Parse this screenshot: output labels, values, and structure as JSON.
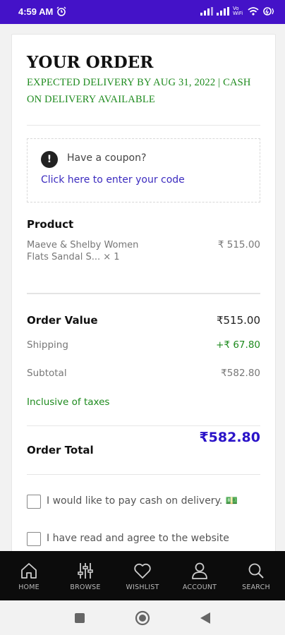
{
  "status_bar": {
    "time": "4:59 AM",
    "signal_text": "Vo WiFi",
    "icons": [
      "alarm-icon",
      "signal-icon",
      "wifi-icon",
      "battery-icon"
    ]
  },
  "order": {
    "title": "YOUR ORDER",
    "delivery_note": "EXPECTED DELIVERY BY AUG 31, 2022 | CASH ON DELIVERY AVAILABLE"
  },
  "coupon": {
    "prompt": "Have a coupon?",
    "link_text": "Click here to enter your code"
  },
  "product_section": {
    "header": "Product",
    "items": [
      {
        "name": "Maeve & Shelby Women Flats Sandal S...  × 1",
        "price": "₹ 515.00"
      }
    ]
  },
  "summary": {
    "order_value_label": "Order Value",
    "order_value": "₹515.00",
    "shipping_label": "Shipping",
    "shipping_value": "+₹ 67.80",
    "subtotal_label": "Subtotal",
    "subtotal_value": "₹582.80",
    "tax_note": "Inclusive of taxes",
    "total_label": "Order Total",
    "total_value": "₹582.80"
  },
  "options": {
    "cod_label": "I would like to pay cash on delivery. 💵",
    "terms_label": "I have read and agree to the website"
  },
  "bottom_nav": [
    {
      "label": "HOME",
      "icon": "home-icon"
    },
    {
      "label": "BROWSE",
      "icon": "sliders-icon"
    },
    {
      "label": "WISHLIST",
      "icon": "heart-icon"
    },
    {
      "label": "ACCOUNT",
      "icon": "user-icon"
    },
    {
      "label": "SEARCH",
      "icon": "search-icon"
    }
  ],
  "colors": {
    "status_bar": "#4412c8",
    "green": "#1d8a1d",
    "link": "#3b2bbf",
    "total": "#2a13c8",
    "nav_bg": "#0c0c0c"
  }
}
